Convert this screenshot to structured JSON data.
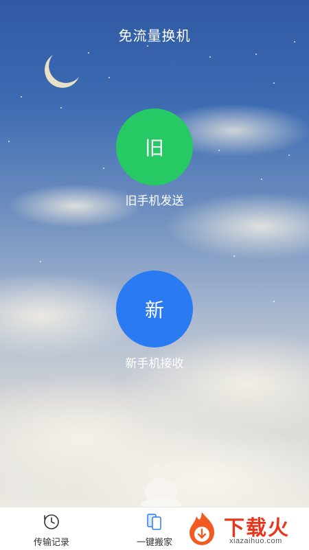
{
  "header": {
    "title": "免流量换机"
  },
  "old_phone": {
    "circle_label": "旧",
    "caption": "旧手机发送",
    "color": "#27c964"
  },
  "new_phone": {
    "circle_label": "新",
    "caption": "新手机接收",
    "color": "#2a7af2"
  },
  "tabbar": {
    "items": [
      {
        "label": "传输记录",
        "icon": "history-clock-icon"
      },
      {
        "label": "一键搬家",
        "icon": "phone-transfer-icon"
      }
    ]
  },
  "watermark": {
    "text": "下载火",
    "url": "xiazaihuo.com"
  }
}
